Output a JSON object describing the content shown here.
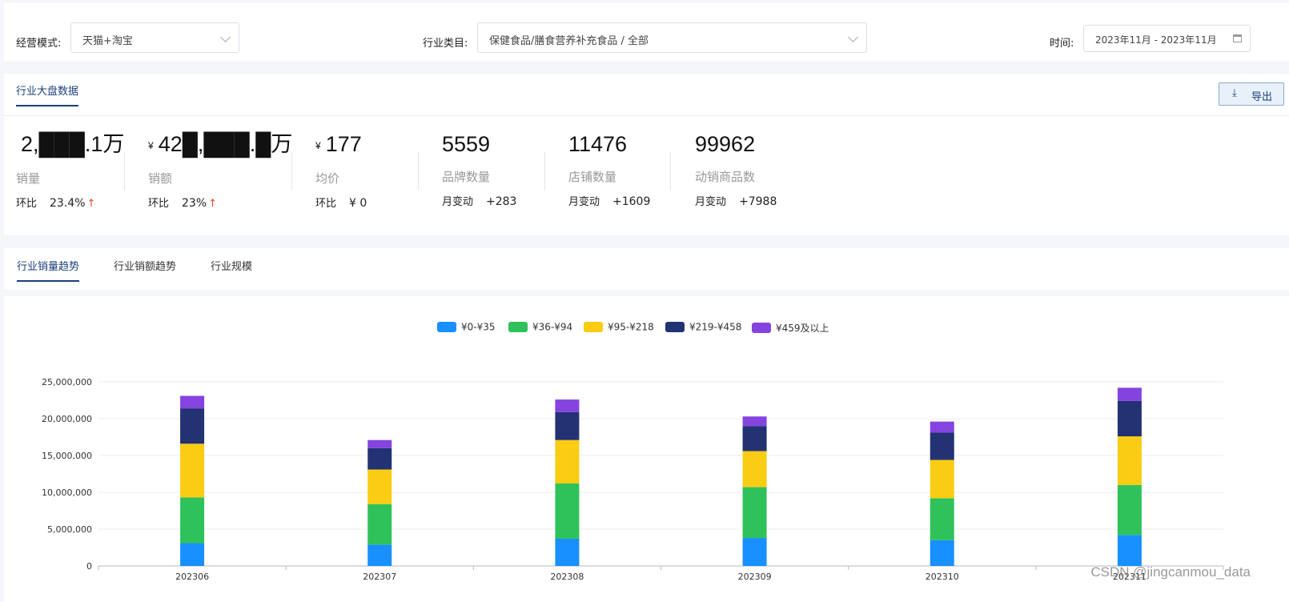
{
  "filters": {
    "mode_label": "经营模式:",
    "mode_value": "天猫+淘宝",
    "category_label": "行业类目:",
    "category_value": "保健食品/膳食营养补充食品 / 全部",
    "time_label": "时间:",
    "time_value": "2023年11月 - 2023年11月"
  },
  "overview": {
    "tab_label": "行业大盘数据",
    "export_label": "导出",
    "stats": [
      {
        "value": "2,███.1万",
        "currency": "",
        "label": "销量",
        "change_label": "环比",
        "change_value": "23.4%",
        "arrow": "↑"
      },
      {
        "value": "42█,███.█万",
        "currency": "¥",
        "label": "销额",
        "change_label": "环比",
        "change_value": "23%",
        "arrow": "↑"
      },
      {
        "value": "177",
        "currency": "¥",
        "label": "均价",
        "change_label": "环比",
        "change_value": "¥ 0",
        "arrow": ""
      },
      {
        "value": "5559",
        "currency": "",
        "label": "品牌数量",
        "change_label": "月变动",
        "change_value": "+283",
        "arrow": ""
      },
      {
        "value": "11476",
        "currency": "",
        "label": "店铺数量",
        "change_label": "月变动",
        "change_value": "+1609",
        "arrow": ""
      },
      {
        "value": "99962",
        "currency": "",
        "label": "动销商品数",
        "change_label": "月变动",
        "change_value": "+7988",
        "arrow": ""
      }
    ]
  },
  "trend_tabs": [
    {
      "label": "行业销量趋势",
      "active": true
    },
    {
      "label": "行业销额趋势",
      "active": false
    },
    {
      "label": "行业规模",
      "active": false
    }
  ],
  "watermark": "CSDN @jingcanmou_data",
  "chart_data": {
    "type": "bar",
    "stacked": true,
    "categories": [
      "202306",
      "202307",
      "202308",
      "202309",
      "202310",
      "202311"
    ],
    "series": [
      {
        "name": "¥0-¥35",
        "color": "#1890ff",
        "values": [
          3100000,
          2900000,
          3700000,
          3800000,
          3500000,
          4200000
        ]
      },
      {
        "name": "¥36-¥94",
        "color": "#2fc25b",
        "values": [
          6200000,
          5500000,
          7500000,
          6900000,
          5700000,
          6800000
        ]
      },
      {
        "name": "¥95-¥218",
        "color": "#facc14",
        "values": [
          7300000,
          4700000,
          5900000,
          4900000,
          5200000,
          6600000
        ]
      },
      {
        "name": "¥219-¥458",
        "color": "#223273",
        "values": [
          4800000,
          2900000,
          3800000,
          3400000,
          3700000,
          4800000
        ]
      },
      {
        "name": "¥459及以上",
        "color": "#8543e0",
        "values": [
          1700000,
          1100000,
          1700000,
          1300000,
          1500000,
          1800000
        ]
      }
    ],
    "ylim": [
      0,
      25000000
    ],
    "yticks": [
      "0",
      "5,000,000",
      "10,000,000",
      "15,000,000",
      "20,000,000",
      "25,000,000"
    ],
    "grid": true,
    "legend": "top-center"
  }
}
